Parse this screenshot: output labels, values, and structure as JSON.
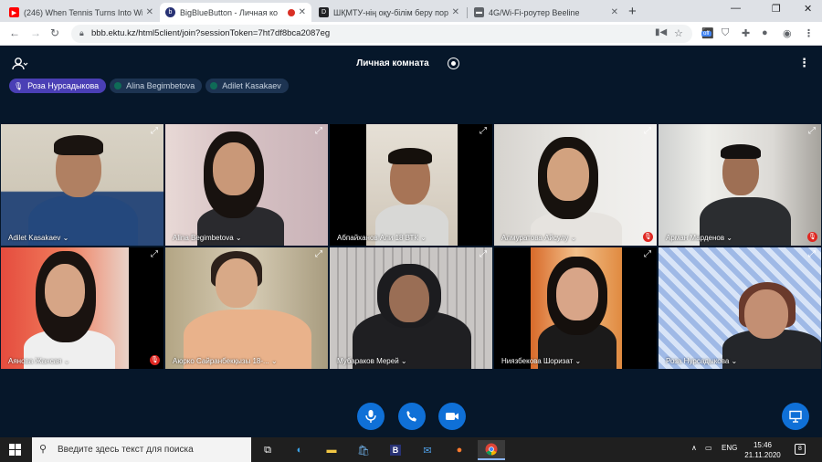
{
  "browser": {
    "tabs": [
      {
        "title": "(246) When Tennis Turns Into Wi",
        "favicon_color": "#ff0000",
        "glyph": "▶"
      },
      {
        "title": "BigBlueButton - Личная ко",
        "favicon_color": "#283274",
        "glyph": "b",
        "active": true
      },
      {
        "title": "ШҚМТУ-нің оқу-білім беру пор",
        "favicon_color": "#202124",
        "glyph": "D"
      },
      {
        "title": "4G/Wi-Fi-роутер Beeline",
        "favicon_color": "#5f6368",
        "glyph": "▬"
      }
    ],
    "url": "bbb.ektu.kz/html5client/join?sessionToken=7ht7df8bca2087eg",
    "ext_badge": "off"
  },
  "meeting": {
    "room_title": "Личная комната",
    "talkers": [
      {
        "name": "Роза Нурсадыкова",
        "speaking": true
      },
      {
        "name": "Alina Begimbetova",
        "speaking": false
      },
      {
        "name": "Adilet Kasakaev",
        "speaking": false
      }
    ],
    "videos": [
      {
        "name": "Adilet Kasakaev ⌄",
        "muted": false
      },
      {
        "name": "Alina Begimbetova ⌄",
        "muted": false
      },
      {
        "name": "Абпайханов Али 18 ВТК ⌄",
        "muted": false
      },
      {
        "name": "Алмуратова Айсулу ⌄",
        "muted": true
      },
      {
        "name": "Арман Марденов ⌄",
        "muted": true
      },
      {
        "name": "Аянова Жансая ⌄",
        "muted": true
      },
      {
        "name": "Аюрко Сайранбекқызы 18-... ⌄",
        "muted": false
      },
      {
        "name": "Мубараков Мерей ⌄",
        "muted": false
      },
      {
        "name": "Ниязбекова Шоризат ⌄",
        "muted": false
      },
      {
        "name": "Роза Нурсадыкова ⌄",
        "muted": false
      }
    ]
  },
  "taskbar": {
    "search_placeholder": "Введите здесь текст для поиска",
    "language": "ENG",
    "time": "15:46",
    "date": "21.11.2020",
    "notifications": "8"
  }
}
